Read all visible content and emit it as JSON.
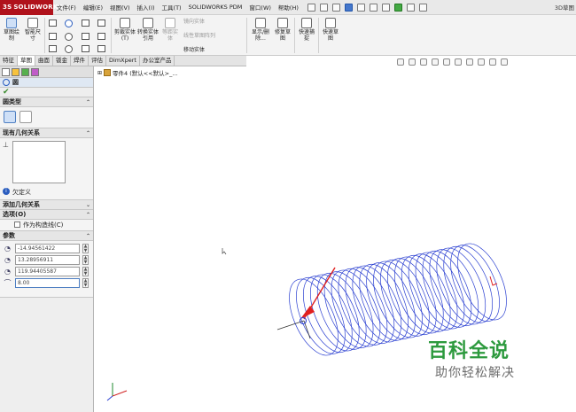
{
  "app": {
    "logo": "SOLIDWORKS",
    "title": "3D草图"
  },
  "menu": [
    "文件(F)",
    "编辑(E)",
    "视图(V)",
    "插入(I)",
    "工具(T)",
    "SOLIDWORKS PDM",
    "窗口(W)",
    "帮助(H)"
  ],
  "ribbon": {
    "sketch_btn": "草图绘制",
    "smart_dim": "智能尺寸",
    "trim": "剪裁实体(T)",
    "convert": "转换实体引用",
    "offset": "等距实体",
    "mirror": "镜向实体",
    "linear_pattern": "线性草图阵列",
    "move": "移动实体",
    "display_delete": "显示/删除...",
    "repair": "修复草图",
    "quick_snap": "快速捕捉",
    "rapid_sketch": "快速草图"
  },
  "tabs": [
    "特征",
    "草图",
    "曲面",
    "钣金",
    "焊件",
    "评估",
    "DimXpert",
    "办公室产品"
  ],
  "tree": {
    "root_label": "零件4 (默认<<默认>_..."
  },
  "property_manager": {
    "title": "圆",
    "sections": {
      "circle_type": "圆类型",
      "existing_relations": "现有几何关系",
      "add_relations": "添加几何关系",
      "options": "选项(O)",
      "parameters": "参数"
    },
    "relation_status": "欠定义",
    "construction_label": "作为构造线(C)",
    "params": {
      "x": "-14.94561422",
      "y": "13.28956911",
      "z": "119.94405587",
      "radius": "8.00"
    }
  },
  "watermark": {
    "title": "百科全说",
    "subtitle": "助你轻松解决"
  },
  "colors": {
    "helix": "#2a3fd1",
    "watermark_green": "#2d9a3e",
    "brand": "#b0121b"
  }
}
